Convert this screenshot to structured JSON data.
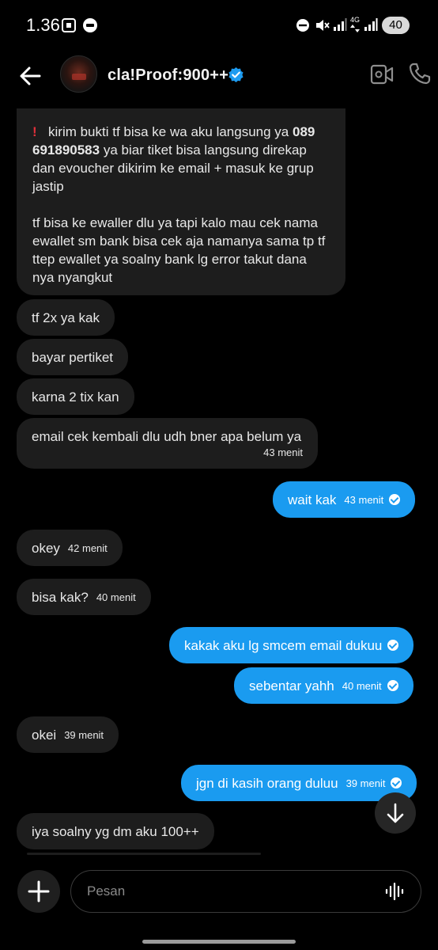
{
  "status_bar": {
    "time": "1.36",
    "network": "4G",
    "battery": "40"
  },
  "header": {
    "contact_name": "cla!Proof:900++"
  },
  "messages": {
    "pinned_text_1_before": "kirim bukti tf bisa ke wa aku langsung ya",
    "pinned_phone": "089 691890583",
    "pinned_text_1_after": "ya biar tiket bisa langsung direkap dan evoucher dikirim ke email + masuk ke grup jastip",
    "pinned_text_2": "tf bisa ke ewaller dlu ya tapi kalo mau cek nama ewallet sm bank bisa cek aja namanya sama tp tf ttep ewallet ya soalny bank lg error takut dana nya nyangkut",
    "m1": "tf 2x ya kak",
    "m2": "bayar pertiket",
    "m3": "karna 2 tix kan",
    "m4": "email cek kembali dlu udh bner apa belum ya",
    "m4_time": "43 menit",
    "m5": "wait kak",
    "m5_time": "43 menit",
    "m6": "okey",
    "m6_time": "42 menit",
    "m7": "bisa kak?",
    "m7_time": "40 menit",
    "m8": "kakak aku lg smcem email dukuu",
    "m9": "sebentar yahh",
    "m9_time": "40 menit",
    "m10": "okei",
    "m10_time": "39 menit",
    "m11": "jgn di kasih orang duluu",
    "m11_time": "39 menit",
    "m12": "iya soalny yg dm aku 100++"
  },
  "composer": {
    "placeholder": "Pesan"
  },
  "colors": {
    "background": "#000000",
    "incoming_bubble": "#1d1d1d",
    "outgoing_bubble": "#1a9bf0",
    "verified_badge": "#1d9bf0",
    "alert": "#e0303a"
  },
  "icons": [
    "back-arrow-icon",
    "verified-badge-icon",
    "video-call-icon",
    "phone-icon",
    "plus-icon",
    "voice-wave-icon",
    "arrow-down-icon",
    "read-check-icon"
  ]
}
